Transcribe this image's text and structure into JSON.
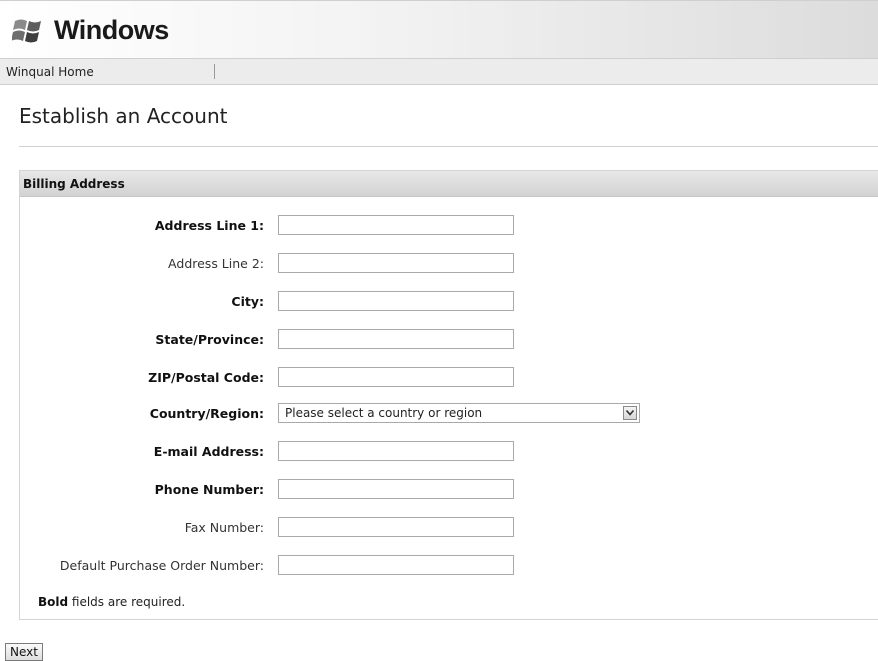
{
  "header": {
    "logo_text": "Windows"
  },
  "nav": {
    "home_link": "Winqual Home"
  },
  "page": {
    "title": "Establish an Account"
  },
  "section": {
    "title": "Billing Address"
  },
  "form": {
    "fields": [
      {
        "label": "Address Line 1:",
        "required": true,
        "value": ""
      },
      {
        "label": "Address Line 2:",
        "required": false,
        "value": ""
      },
      {
        "label": "City:",
        "required": true,
        "value": ""
      },
      {
        "label": "State/Province:",
        "required": true,
        "value": ""
      },
      {
        "label": "ZIP/Postal Code:",
        "required": true,
        "value": ""
      },
      {
        "label": "Country/Region:",
        "required": true,
        "selected": "Please select a country or region"
      },
      {
        "label": "E-mail Address:",
        "required": true,
        "value": ""
      },
      {
        "label": "Phone Number:",
        "required": true,
        "value": ""
      },
      {
        "label": "Fax Number:",
        "required": false,
        "value": ""
      },
      {
        "label": "Default Purchase Order Number:",
        "required": false,
        "value": ""
      }
    ],
    "note_bold": "Bold",
    "note_rest": " fields are required."
  },
  "actions": {
    "next_label": "Next"
  },
  "icons": {
    "logo": "windows-flag-icon",
    "dropdown": "chevron-down-icon"
  }
}
